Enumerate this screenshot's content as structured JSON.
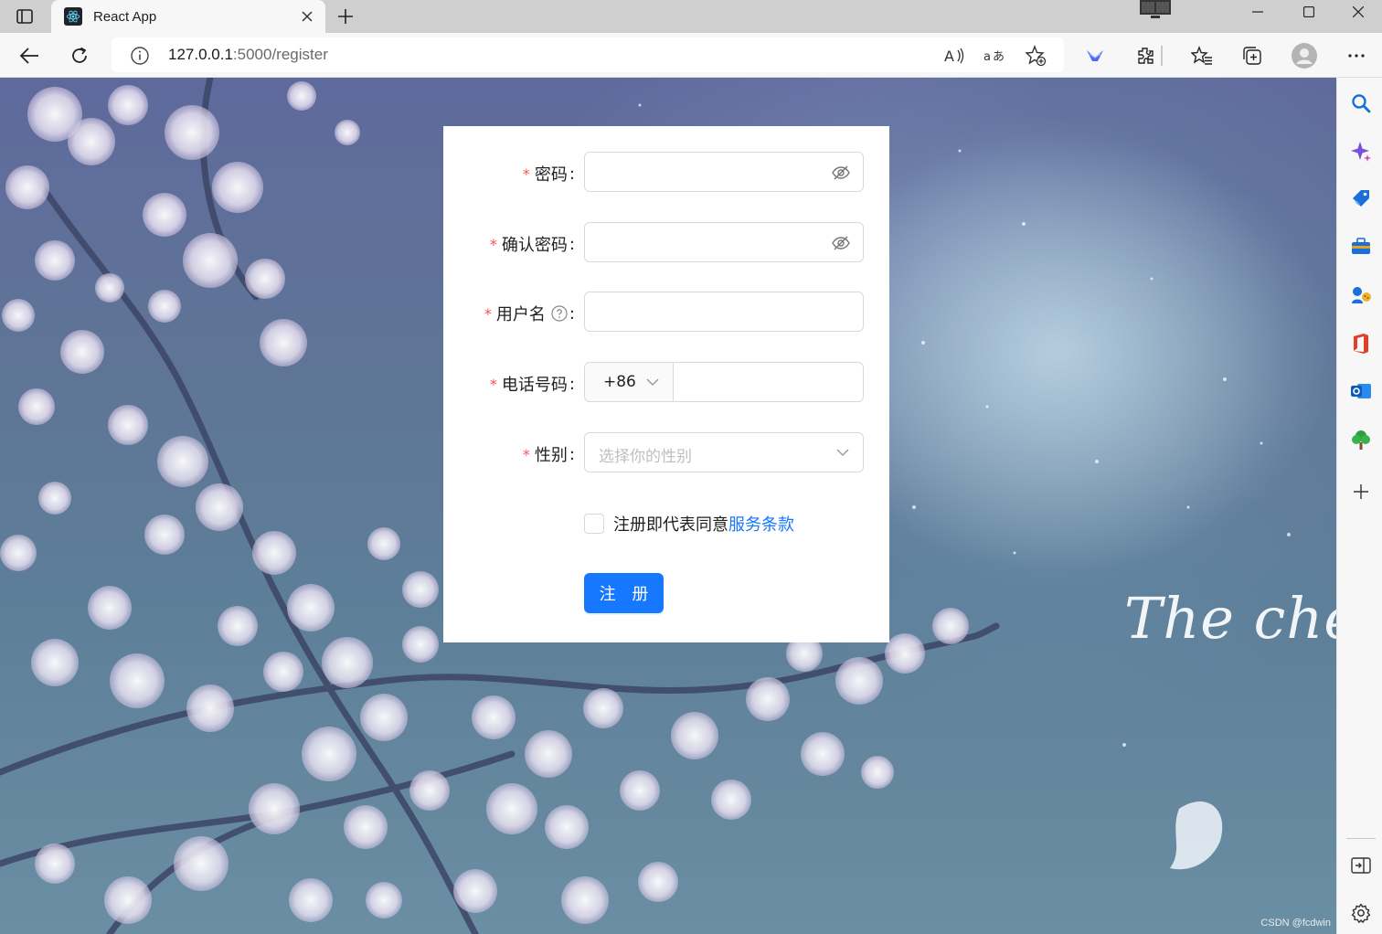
{
  "browser": {
    "tab": {
      "title": "React App"
    },
    "address": {
      "host": "127.0.0.1",
      "path": ":5000/register"
    }
  },
  "form": {
    "password": {
      "label": "密码"
    },
    "confirm_password": {
      "label": "确认密码"
    },
    "username": {
      "label": "用户名"
    },
    "phone": {
      "label": "电话号码",
      "prefix": "+86"
    },
    "gender": {
      "label": "性别",
      "placeholder": "选择你的性别"
    },
    "agreement": {
      "text": "注册即代表同意",
      "link": "服务条款"
    },
    "submit_label": "注 册",
    "required_mark": "*",
    "colon": ":"
  },
  "background": {
    "caption": "The cherry"
  },
  "watermark": "CSDN @fcdwin",
  "colors": {
    "primary": "#1677ff",
    "required": "#ff4d4f"
  },
  "sidebar_icons": [
    "search-icon",
    "copilot-icon",
    "shopping-tag-icon",
    "tools-icon",
    "games-icon",
    "office-icon",
    "outlook-icon",
    "tree-icon",
    "add-icon",
    "split-screen-icon",
    "settings-icon"
  ]
}
